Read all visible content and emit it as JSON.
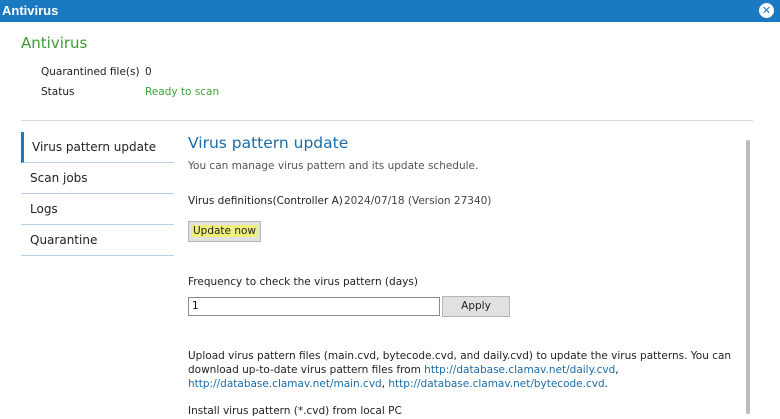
{
  "window": {
    "title": "Antivirus"
  },
  "header": {
    "title": "Antivirus"
  },
  "info": {
    "quarantined_label": "Quarantined file(s)",
    "quarantined_value": "0",
    "status_label": "Status",
    "status_value": "Ready to scan"
  },
  "sidebar": {
    "items": [
      {
        "label": "Virus pattern update"
      },
      {
        "label": "Scan jobs"
      },
      {
        "label": "Logs"
      },
      {
        "label": "Quarantine"
      }
    ]
  },
  "main": {
    "title": "Virus pattern update",
    "description": "You can manage virus pattern and its update schedule.",
    "defs_label": "Virus definitions(Controller A)",
    "defs_value": "2024/07/18 (Version 27340)",
    "update_button": "Update now",
    "frequency_label": "Frequency to check the virus pattern (days)",
    "frequency_value": "1",
    "apply_button": "Apply",
    "upload_text": "Upload virus pattern files (main.cvd, bytecode.cvd, and daily.cvd) to update the virus patterns. You can download up-to-date virus pattern files from",
    "links": [
      "http://database.clamav.net/daily.cvd",
      "http://database.clamav.net/main.cvd",
      "http://database.clamav.net/bytecode.cvd"
    ],
    "install_label": "Install virus pattern (*.cvd) from local PC"
  },
  "colors": {
    "titlebar": "#1b79c1",
    "accent_green": "#3d9b35",
    "link_blue": "#1b6ca8",
    "highlight": "#f0ef7a"
  }
}
